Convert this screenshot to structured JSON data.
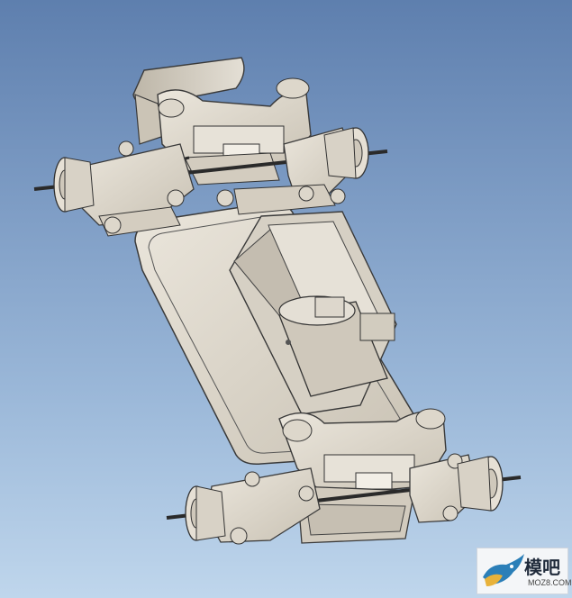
{
  "viewport": {
    "background_top": "#5e7fae",
    "background_bottom": "#bfd6ec",
    "part_color": "#d8d2c6",
    "edge_color": "#3a3a3a",
    "axle_color": "#2a2a2a"
  },
  "watermark": {
    "title": "模吧",
    "subtitle": "MOZ8.COM",
    "logo": "bird-logo-icon"
  }
}
